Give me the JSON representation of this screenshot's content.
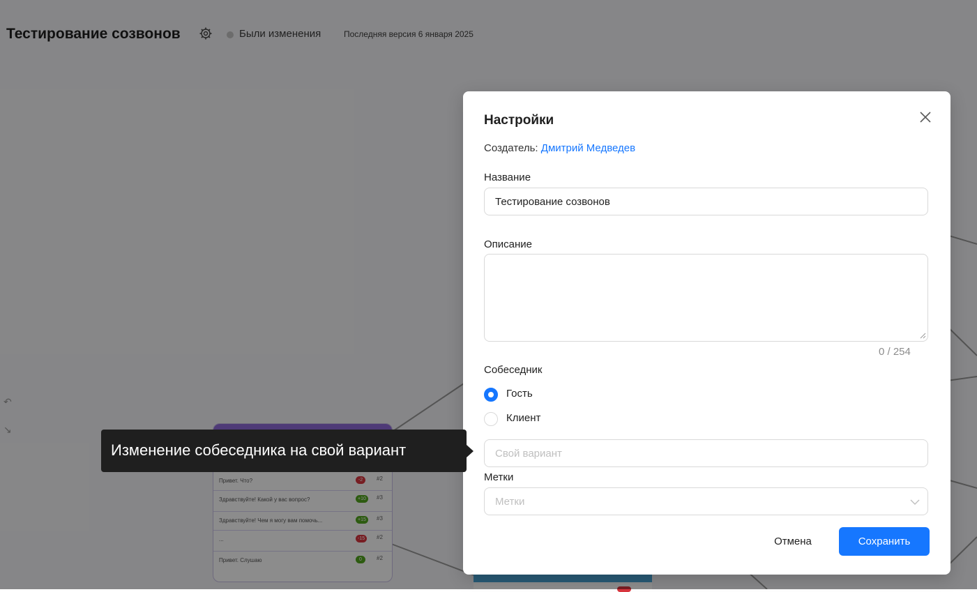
{
  "header": {
    "title": "Тестирование созвонов",
    "status": "Были изменения",
    "version": "Последняя версия 6 января 2025"
  },
  "node": {
    "rows": [
      {
        "text": "Привет. Что?",
        "badge": "-2",
        "badge_color": "#d9363e",
        "num": "#2"
      },
      {
        "text": "Здравствуйте! Какой у вас вопрос?",
        "badge": "+10",
        "badge_color": "#52a61e",
        "num": "#3"
      },
      {
        "text": "Здравствуйте! Чем я могу вам помочь...",
        "badge": "+15",
        "badge_color": "#52a61e",
        "num": "#3"
      },
      {
        "text": "...",
        "badge": "-15",
        "badge_color": "#d9363e",
        "num": "#2"
      },
      {
        "text": "Привет. Слушаю",
        "badge": "0",
        "badge_color": "#52a61e",
        "num": "#2"
      }
    ]
  },
  "modal": {
    "title": "Настройки",
    "creator_label": "Создатель: ",
    "creator_name": "Дмитрий Медведев",
    "name_label": "Название",
    "name_value": "Тестирование созвонов",
    "description_label": "Описание",
    "description_value": "",
    "counter": "0 / 254",
    "interlocutor_label": "Собеседник",
    "radio_guest": "Гость",
    "radio_client": "Клиент",
    "custom_placeholder": "Свой вариант",
    "tags_label": "Метки",
    "tags_placeholder": "Метки",
    "cancel_label": "Отмена",
    "save_label": "Сохранить"
  },
  "tooltip": {
    "text": "Изменение собеседника на свой вариант"
  },
  "colors": {
    "accent": "#1677ff",
    "node_header": "#8e6bd9",
    "blue_node": "#4aa5d6"
  }
}
